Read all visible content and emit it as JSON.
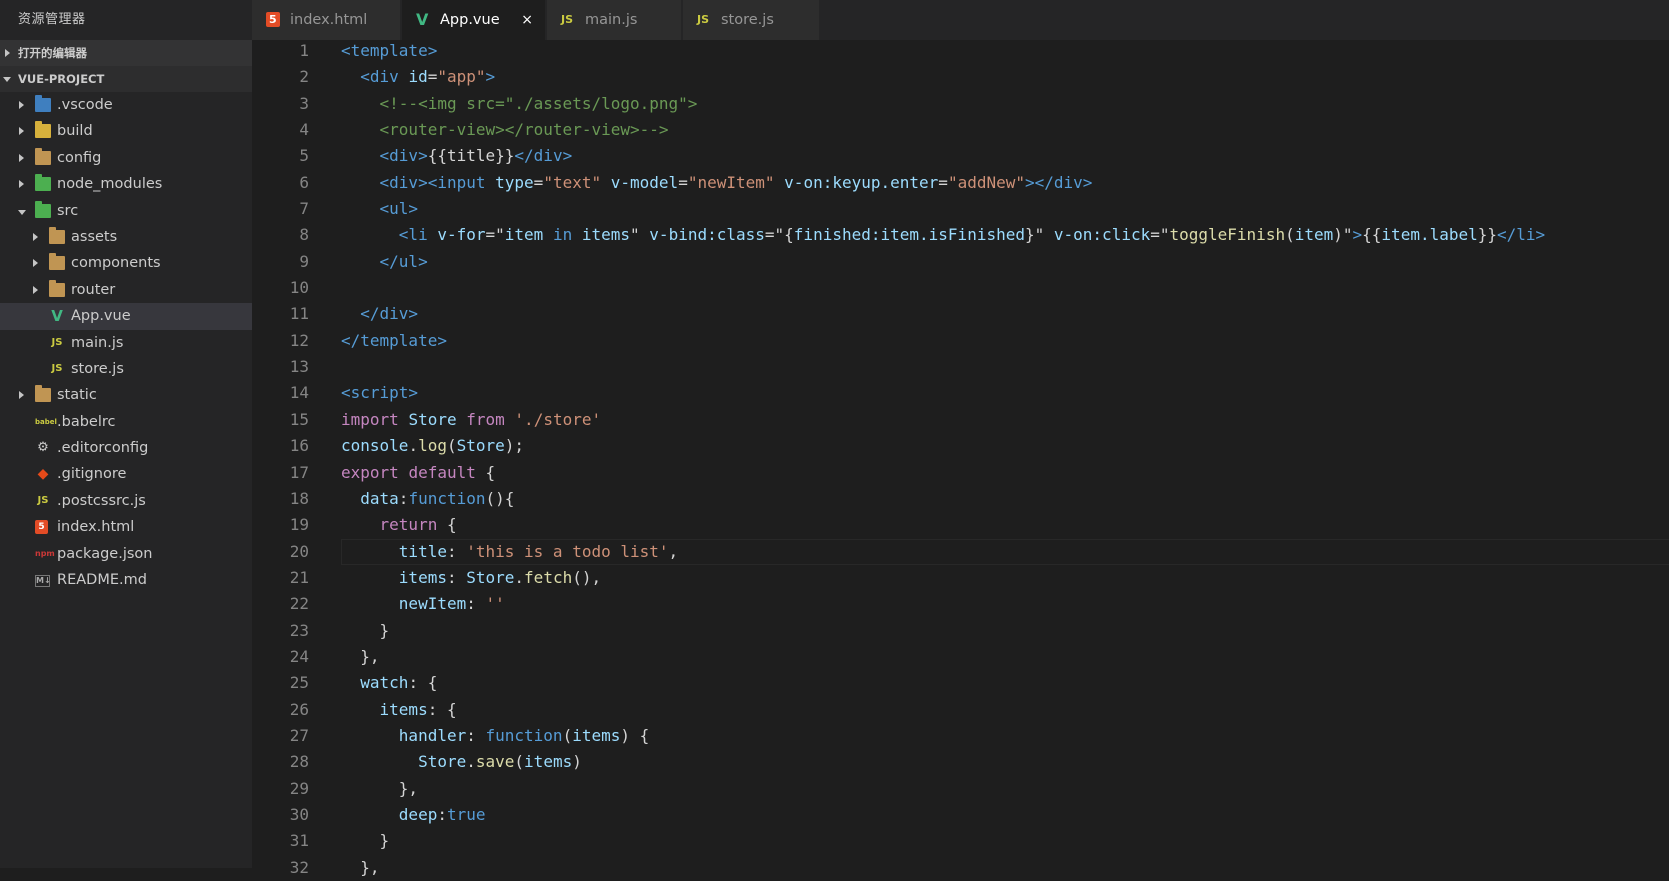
{
  "sidebar": {
    "title": "资源管理器",
    "open_editors": "打开的编辑器",
    "project": "VUE-PROJECT",
    "items": [
      {
        "label": ".vscode",
        "icon": "folder-vscode-icon",
        "depth": 1,
        "chevron": "closed"
      },
      {
        "label": "build",
        "icon": "folder-build-icon",
        "depth": 1,
        "chevron": "closed"
      },
      {
        "label": "config",
        "icon": "folder-icon",
        "depth": 1,
        "chevron": "closed"
      },
      {
        "label": "node_modules",
        "icon": "folder-node-icon",
        "depth": 1,
        "chevron": "closed"
      },
      {
        "label": "src",
        "icon": "folder-src-icon",
        "depth": 1,
        "chevron": "open"
      },
      {
        "label": "assets",
        "icon": "folder-icon",
        "depth": 2,
        "chevron": "closed"
      },
      {
        "label": "components",
        "icon": "folder-icon",
        "depth": 2,
        "chevron": "closed"
      },
      {
        "label": "router",
        "icon": "folder-icon",
        "depth": 2,
        "chevron": "closed"
      },
      {
        "label": "App.vue",
        "icon": "vue-icon",
        "depth": 2,
        "chevron": "none",
        "selected": true
      },
      {
        "label": "main.js",
        "icon": "js-icon",
        "depth": 2,
        "chevron": "none"
      },
      {
        "label": "store.js",
        "icon": "js-icon",
        "depth": 2,
        "chevron": "none"
      },
      {
        "label": "static",
        "icon": "folder-icon",
        "depth": 1,
        "chevron": "closed"
      },
      {
        "label": ".babelrc",
        "icon": "babel-icon",
        "depth": 1,
        "chevron": "none"
      },
      {
        "label": ".editorconfig",
        "icon": "gear-icon",
        "depth": 1,
        "chevron": "none"
      },
      {
        "label": ".gitignore",
        "icon": "git-icon",
        "depth": 1,
        "chevron": "none"
      },
      {
        "label": ".postcssrc.js",
        "icon": "js-icon",
        "depth": 1,
        "chevron": "none"
      },
      {
        "label": "index.html",
        "icon": "html-icon",
        "depth": 1,
        "chevron": "none"
      },
      {
        "label": "package.json",
        "icon": "npm-icon",
        "depth": 1,
        "chevron": "none"
      },
      {
        "label": "README.md",
        "icon": "markdown-icon",
        "depth": 1,
        "chevron": "none"
      }
    ]
  },
  "tabs": [
    {
      "label": "index.html",
      "icon": "html-icon",
      "icon_text": "5",
      "active": false
    },
    {
      "label": "App.vue",
      "icon": "vue-icon",
      "icon_text": "V",
      "active": true,
      "close": "×"
    },
    {
      "label": "main.js",
      "icon": "js-icon",
      "icon_text": "JS",
      "active": false
    },
    {
      "label": "store.js",
      "icon": "js-icon",
      "icon_text": "JS",
      "active": false
    }
  ],
  "editor": {
    "current_line": 20,
    "lines": [
      [
        [
          "tag",
          "<template>"
        ]
      ],
      [
        [
          "d",
          "  "
        ],
        [
          "tag",
          "<div"
        ],
        [
          "d",
          " "
        ],
        [
          "att",
          "id"
        ],
        [
          "d",
          "="
        ],
        [
          "str",
          "\"app\""
        ],
        [
          "tag",
          ">"
        ]
      ],
      [
        [
          "d",
          "    "
        ],
        [
          "com",
          "<!--<img src=\"./assets/logo.png\">"
        ]
      ],
      [
        [
          "d",
          "    "
        ],
        [
          "com",
          "<router-view></router-view>-->"
        ]
      ],
      [
        [
          "d",
          "    "
        ],
        [
          "tag",
          "<div>"
        ],
        [
          "d",
          "{{title}}"
        ],
        [
          "tag",
          "</div>"
        ]
      ],
      [
        [
          "d",
          "    "
        ],
        [
          "tag",
          "<div><input"
        ],
        [
          "d",
          " "
        ],
        [
          "att",
          "type"
        ],
        [
          "d",
          "="
        ],
        [
          "str",
          "\"text\""
        ],
        [
          "d",
          " "
        ],
        [
          "att",
          "v-model"
        ],
        [
          "d",
          "="
        ],
        [
          "str",
          "\"newItem\""
        ],
        [
          "d",
          " "
        ],
        [
          "att",
          "v-on:keyup.enter"
        ],
        [
          "d",
          "="
        ],
        [
          "str",
          "\"addNew\""
        ],
        [
          "tag",
          "></div>"
        ]
      ],
      [
        [
          "d",
          "    "
        ],
        [
          "tag",
          "<ul>"
        ]
      ],
      [
        [
          "d",
          "      "
        ],
        [
          "tag",
          "<li"
        ],
        [
          "d",
          " "
        ],
        [
          "att",
          "v-for"
        ],
        [
          "d",
          "=\""
        ],
        [
          "att",
          "item"
        ],
        [
          "d",
          " "
        ],
        [
          "tag",
          "in"
        ],
        [
          "d",
          " "
        ],
        [
          "att",
          "items"
        ],
        [
          "d",
          "\" "
        ],
        [
          "att",
          "v-bind:class"
        ],
        [
          "d",
          "=\"{"
        ],
        [
          "att",
          "finished:item.isFinished"
        ],
        [
          "d",
          "}\" "
        ],
        [
          "att",
          "v-on:click"
        ],
        [
          "d",
          "=\""
        ],
        [
          "fn",
          "toggleFinish"
        ],
        [
          "d",
          "("
        ],
        [
          "att",
          "item"
        ],
        [
          "d",
          ")\""
        ],
        [
          "tag",
          ">"
        ],
        [
          "d",
          "{{"
        ],
        [
          "att",
          "item.label"
        ],
        [
          "d",
          "}}"
        ],
        [
          "tag",
          "</li>"
        ]
      ],
      [
        [
          "d",
          "    "
        ],
        [
          "tag",
          "</ul>"
        ]
      ],
      [
        [
          "d",
          ""
        ]
      ],
      [
        [
          "d",
          "  "
        ],
        [
          "tag",
          "</div>"
        ]
      ],
      [
        [
          "tag",
          "</template>"
        ]
      ],
      [
        [
          "d",
          ""
        ]
      ],
      [
        [
          "tag",
          "<script>"
        ]
      ],
      [
        [
          "kw",
          "import"
        ],
        [
          "d",
          " "
        ],
        [
          "att",
          "Store"
        ],
        [
          "d",
          " "
        ],
        [
          "kw",
          "from"
        ],
        [
          "d",
          " "
        ],
        [
          "str",
          "'./store'"
        ]
      ],
      [
        [
          "att",
          "console"
        ],
        [
          "d",
          "."
        ],
        [
          "fn",
          "log"
        ],
        [
          "d",
          "("
        ],
        [
          "att",
          "Store"
        ],
        [
          "d",
          ");"
        ]
      ],
      [
        [
          "kw",
          "export"
        ],
        [
          "d",
          " "
        ],
        [
          "kw",
          "default"
        ],
        [
          "d",
          " {"
        ]
      ],
      [
        [
          "d",
          "  "
        ],
        [
          "att",
          "data"
        ],
        [
          "d",
          ":"
        ],
        [
          "bool",
          "function"
        ],
        [
          "d",
          "(){"
        ]
      ],
      [
        [
          "d",
          "    "
        ],
        [
          "kw",
          "return"
        ],
        [
          "d",
          " {"
        ]
      ],
      [
        [
          "d",
          "      "
        ],
        [
          "att",
          "title"
        ],
        [
          "d",
          ": "
        ],
        [
          "str",
          "'this is a todo list'"
        ],
        [
          "d",
          ","
        ]
      ],
      [
        [
          "d",
          "      "
        ],
        [
          "att",
          "items"
        ],
        [
          "d",
          ": "
        ],
        [
          "att",
          "Store"
        ],
        [
          "d",
          "."
        ],
        [
          "fn",
          "fetch"
        ],
        [
          "d",
          "(),"
        ]
      ],
      [
        [
          "d",
          "      "
        ],
        [
          "att",
          "newItem"
        ],
        [
          "d",
          ": "
        ],
        [
          "str",
          "''"
        ]
      ],
      [
        [
          "d",
          "    }"
        ]
      ],
      [
        [
          "d",
          "  },"
        ]
      ],
      [
        [
          "d",
          "  "
        ],
        [
          "att",
          "watch"
        ],
        [
          "d",
          ": {"
        ]
      ],
      [
        [
          "d",
          "    "
        ],
        [
          "att",
          "items"
        ],
        [
          "d",
          ": {"
        ]
      ],
      [
        [
          "d",
          "      "
        ],
        [
          "att",
          "handler"
        ],
        [
          "d",
          ": "
        ],
        [
          "bool",
          "function"
        ],
        [
          "d",
          "("
        ],
        [
          "att",
          "items"
        ],
        [
          "d",
          ") {"
        ]
      ],
      [
        [
          "d",
          "        "
        ],
        [
          "att",
          "Store"
        ],
        [
          "d",
          "."
        ],
        [
          "fn",
          "save"
        ],
        [
          "d",
          "("
        ],
        [
          "att",
          "items"
        ],
        [
          "d",
          ")"
        ]
      ],
      [
        [
          "d",
          "      },"
        ]
      ],
      [
        [
          "d",
          "      "
        ],
        [
          "att",
          "deep"
        ],
        [
          "d",
          ":"
        ],
        [
          "bool",
          "true"
        ]
      ],
      [
        [
          "d",
          "    }"
        ]
      ],
      [
        [
          "d",
          "  },"
        ]
      ]
    ]
  }
}
